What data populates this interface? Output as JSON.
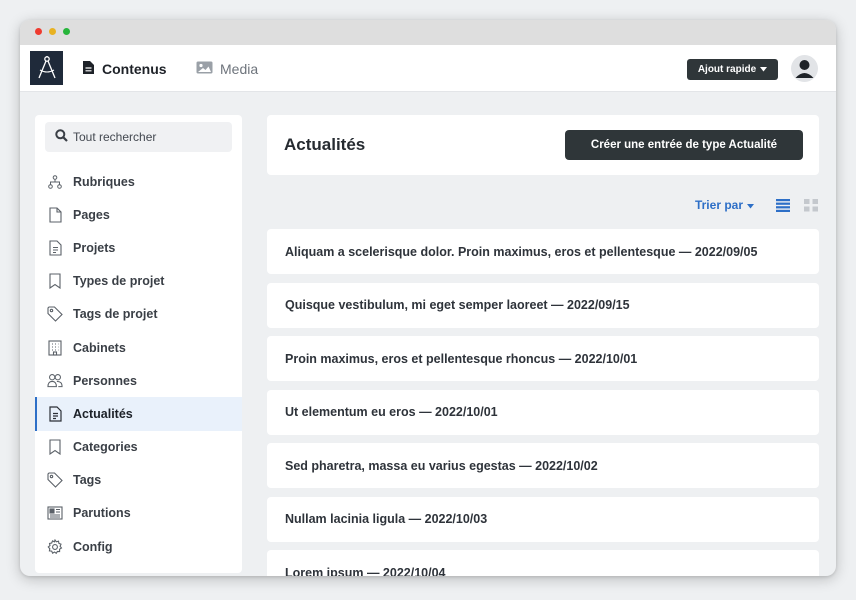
{
  "window": {
    "traffic_lights": [
      "#ef3b2f",
      "#e8b222",
      "#27b53b"
    ]
  },
  "topbar": {
    "logo_icon": "compass-icon",
    "tabs": [
      {
        "label": "Contenus",
        "icon": "document-icon",
        "active": true
      },
      {
        "label": "Media",
        "icon": "image-icon",
        "active": false
      }
    ],
    "quick_add_label": "Ajout rapide",
    "avatar_icon": "user-icon"
  },
  "sidebar": {
    "search_placeholder": "Tout rechercher",
    "items": [
      {
        "label": "Rubriques",
        "icon": "sitemap-icon"
      },
      {
        "label": "Pages",
        "icon": "page-icon"
      },
      {
        "label": "Projets",
        "icon": "file-text-icon"
      },
      {
        "label": "Types de projet",
        "icon": "bookmark-icon"
      },
      {
        "label": "Tags de projet",
        "icon": "tag-icon"
      },
      {
        "label": "Cabinets",
        "icon": "building-icon"
      },
      {
        "label": "Personnes",
        "icon": "users-icon"
      },
      {
        "label": "Actualités",
        "icon": "file-text-icon",
        "active": true
      },
      {
        "label": "Categories",
        "icon": "bookmark-icon"
      },
      {
        "label": "Tags",
        "icon": "tag-icon"
      },
      {
        "label": "Parutions",
        "icon": "newspaper-icon"
      },
      {
        "label": "Config",
        "icon": "gear-icon"
      }
    ]
  },
  "main": {
    "title": "Actualités",
    "create_label": "Créer une entrée de type Actualité",
    "sort_label": "Trier par",
    "entries": [
      "Aliquam a scelerisque dolor. Proin maximus, eros et pellentesque — 2022/09/05",
      "Quisque vestibulum, mi eget semper laoreet — 2022/09/15",
      "Proin maximus, eros et pellentesque rhoncus — 2022/10/01",
      "Ut elementum eu eros — 2022/10/01",
      "Sed pharetra, massa eu varius egestas — 2022/10/02",
      "Nullam lacinia ligula — 2022/10/03",
      "Lorem ipsum — 2022/10/04"
    ]
  },
  "colors": {
    "accent": "#2d6fc7",
    "dark_button": "#2f3639",
    "active_item_bg": "#e9f1fb"
  }
}
